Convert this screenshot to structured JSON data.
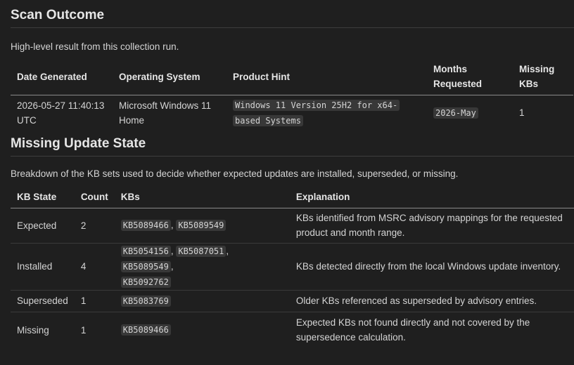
{
  "scan_outcome": {
    "title": "Scan Outcome",
    "description": "High-level result from this collection run.",
    "columns": {
      "date_generated": "Date Generated",
      "operating_system": "Operating System",
      "product_hint": "Product Hint",
      "months_requested_line1": "Months",
      "months_requested_line2": "Requested",
      "missing_kbs_line1": "Missing",
      "missing_kbs_line2": "KBs"
    },
    "row": {
      "date_generated_line1": "2026-05-27 11:40:13",
      "date_generated_line2": "UTC",
      "operating_system_line1": "Microsoft Windows 11",
      "operating_system_line2": "Home",
      "product_hint_line1": "Windows 11 Version 25H2 for x64-",
      "product_hint_line2": "based Systems",
      "months_requested": "2026-May",
      "missing_kbs": "1"
    }
  },
  "missing_update_state": {
    "title": "Missing Update State",
    "description": "Breakdown of the KB sets used to decide whether expected updates are installed, superseded, or missing.",
    "columns": {
      "kb_state": "KB State",
      "count": "Count",
      "kbs": "KBs",
      "explanation": "Explanation"
    },
    "rows": [
      {
        "state": "Expected",
        "count": "2",
        "kbs": [
          "KB5089466",
          "KB5089549"
        ],
        "explanation_line1": "KBs identified from MSRC advisory mappings for the requested",
        "explanation_line2": "product and month range."
      },
      {
        "state": "Installed",
        "count": "4",
        "kbs": [
          "KB5054156",
          "KB5087051",
          "KB5089549",
          "KB5092762"
        ],
        "explanation_line1": "KBs detected directly from the local Windows update inventory.",
        "explanation_line2": ""
      },
      {
        "state": "Superseded",
        "count": "1",
        "kbs": [
          "KB5083769"
        ],
        "explanation_line1": "Older KBs referenced as superseded by advisory entries.",
        "explanation_line2": ""
      },
      {
        "state": "Missing",
        "count": "1",
        "kbs": [
          "KB5089466"
        ],
        "explanation_line1": "Expected KBs not found directly and not covered by the",
        "explanation_line2": "supersedence calculation."
      }
    ]
  }
}
